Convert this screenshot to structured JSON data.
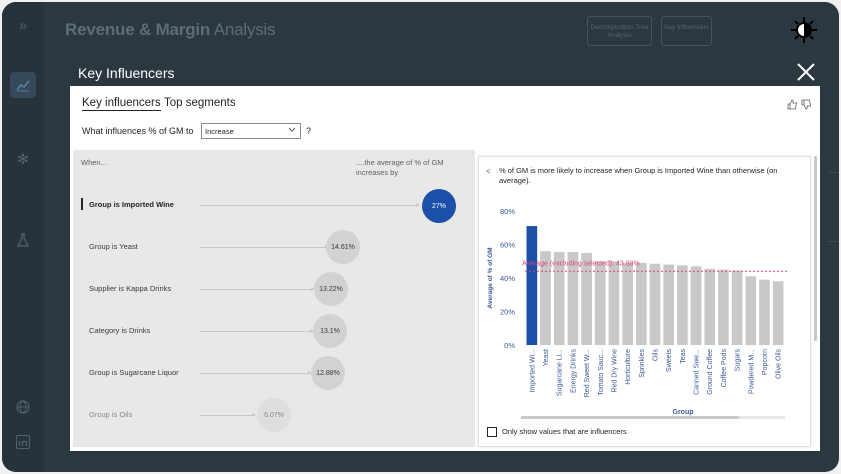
{
  "app": {
    "title_bold": "Revenue & Margin",
    "title_light": "Analysis",
    "buttons": [
      {
        "label": "Decomposition Tree Analysis"
      },
      {
        "label": "Key Influencers"
      }
    ]
  },
  "modal": {
    "title": "Key Influencers",
    "tabs": [
      "Key influencers",
      "Top segments"
    ],
    "question_prefix": "What influences % of GM to",
    "dropdown_value": "Increase",
    "question_suffix": "?",
    "when_label": "When...",
    "avg_label": "....the average of % of GM increases by",
    "influencers": [
      {
        "label": "Group is Imported Wine",
        "value": "27%",
        "selected": true
      },
      {
        "label": "Group is Yeast",
        "value": "14.61%"
      },
      {
        "label": "Supplier is Kappa Drinks",
        "value": "13.22%"
      },
      {
        "label": "Category is Drinks",
        "value": "13.1%"
      },
      {
        "label": "Group is Sugarcane Liquor",
        "value": "12.88%"
      },
      {
        "label": "Group is Oils",
        "value": "6.07%",
        "faded": true
      }
    ],
    "detail": {
      "back": "<",
      "description": "% of GM is more likely to increase when Group is Imported Wine than otherwise (on average).",
      "checkbox_label": "Only show values that are influencers"
    }
  },
  "colors": {
    "highlight": "#1b4fa8",
    "bar": "#c8c8c8",
    "reference_line": "#e0457b",
    "axis_text": "#3b5998"
  },
  "chart_data": {
    "type": "bar",
    "categories": [
      "Imported Wi...",
      "Yeast",
      "Sugarcane Li...",
      "Energy Drinks",
      "Red Sweet W...",
      "Tomato Sauc...",
      "Red Dry Wine",
      "Horticulture",
      "Sprinkles",
      "Oils",
      "Sweets",
      "Teas",
      "Canned Swe...",
      "Ground Coffee",
      "Coffee Pods",
      "Sugars",
      "Powdered M...",
      "Popcorn",
      "Olive Oils"
    ],
    "values": [
      71,
      56,
      55.5,
      55.5,
      55,
      50,
      50,
      49,
      49,
      48.5,
      48,
      47.5,
      47,
      45.5,
      45,
      44.5,
      41,
      39,
      38
    ],
    "highlight_index": 0,
    "ylabel": "Average of % of GM",
    "xlabel": "Group",
    "yticks": [
      "0%",
      "20%",
      "40%",
      "60%",
      "80%"
    ],
    "ylim": [
      0,
      80
    ],
    "reference": {
      "value": 44,
      "label": "Average (excluding selected): 43.88%"
    }
  }
}
